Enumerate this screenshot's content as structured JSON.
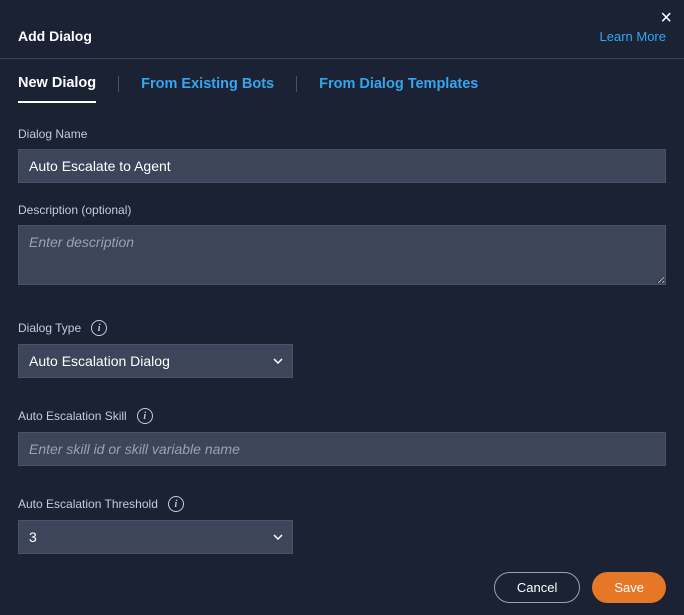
{
  "header": {
    "title": "Add Dialog",
    "learn_more": "Learn More"
  },
  "tabs": {
    "new_dialog": "New Dialog",
    "from_existing": "From Existing Bots",
    "from_templates": "From Dialog Templates"
  },
  "fields": {
    "dialog_name": {
      "label": "Dialog Name",
      "value": "Auto Escalate to Agent"
    },
    "description": {
      "label": "Description (optional)",
      "placeholder": "Enter description"
    },
    "dialog_type": {
      "label": "Dialog Type",
      "selected": "Auto Escalation Dialog"
    },
    "escalation_skill": {
      "label": "Auto Escalation Skill",
      "placeholder": "Enter skill id or skill variable name"
    },
    "escalation_threshold": {
      "label": "Auto Escalation Threshold",
      "selected": "3"
    }
  },
  "footer": {
    "cancel": "Cancel",
    "save": "Save"
  }
}
